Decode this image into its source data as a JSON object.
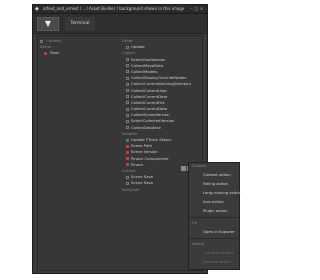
{
  "window": {
    "title": "alfred_and_ernest / .../ Asset Builder / background shown in this image",
    "controls": {
      "min": "–",
      "max": "□",
      "close": "×"
    }
  },
  "toolbar": {
    "logo_icon": "funnel-logo-icon",
    "tab_label": "Terminal"
  },
  "left_column": {
    "sections": [
      {
        "label": "Context",
        "items": []
      },
      {
        "label": "Items",
        "items": [
          {
            "label": "Root",
            "state": "red"
          }
        ]
      }
    ]
  },
  "right_column": {
    "sections": [
      {
        "label": "Other",
        "items": [
          {
            "label": "Update",
            "state": "off"
          }
        ]
      },
      {
        "label": "Collect",
        "items": [
          {
            "label": "SelectHostVersion",
            "state": "off"
          },
          {
            "label": "CollectMayaData",
            "state": "off"
          },
          {
            "label": "CollectModels",
            "state": "off"
          },
          {
            "label": "CollectDisplayOverrideNodes",
            "state": "off"
          },
          {
            "label": "CollectCurrentWorkingDirectory",
            "state": "off"
          },
          {
            "label": "CollectCurrentUser",
            "state": "off"
          },
          {
            "label": "CollectCurrentDate",
            "state": "off"
          },
          {
            "label": "CollectCurrentFile",
            "state": "off"
          },
          {
            "label": "CollectCurrentData",
            "state": "off"
          },
          {
            "label": "CollectSceneVersion",
            "state": "off"
          },
          {
            "label": "SelectCollectedVersion",
            "state": "off"
          },
          {
            "label": "CollectDeadline",
            "state": "off"
          }
        ]
      },
      {
        "label": "Validate",
        "items": [
          {
            "label": "Update FTrack Status",
            "state": "green"
          },
          {
            "label": "Scene Path",
            "state": "red"
          },
          {
            "label": "Scene Version",
            "state": "red"
          },
          {
            "label": "Pinack Components",
            "state": "red"
          },
          {
            "label": "Pinack",
            "state": "red"
          }
        ]
      },
      {
        "label": "Extract",
        "items": [
          {
            "label": "Scene Save",
            "state": "off"
          },
          {
            "label": "Scene Save",
            "state": "off"
          }
        ]
      },
      {
        "label": "Integrate",
        "items": []
      }
    ]
  },
  "context_menu": {
    "sections": [
      {
        "label": "Context",
        "items": [
          {
            "label": "Context action",
            "enabled": true
          },
          {
            "label": "Failing action",
            "enabled": true
          },
          {
            "label": "Long-running action",
            "enabled": true
          },
          {
            "label": "Icon action",
            "enabled": true
          },
          {
            "label": "Plugin action",
            "enabled": true
          }
        ]
      },
      {
        "label": "OS",
        "items": [
          {
            "label": "Open in Explorer",
            "enabled": true
          }
        ]
      },
      {
        "label": "Debug",
        "items": [
          {
            "label": "Unit false action",
            "enabled": false
          },
          {
            "label": "Inactive action",
            "enabled": false
          }
        ]
      }
    ]
  },
  "colors": {
    "green": "#2e9b3a",
    "red": "#cc3a3a",
    "bg": "#3a3a3a"
  }
}
